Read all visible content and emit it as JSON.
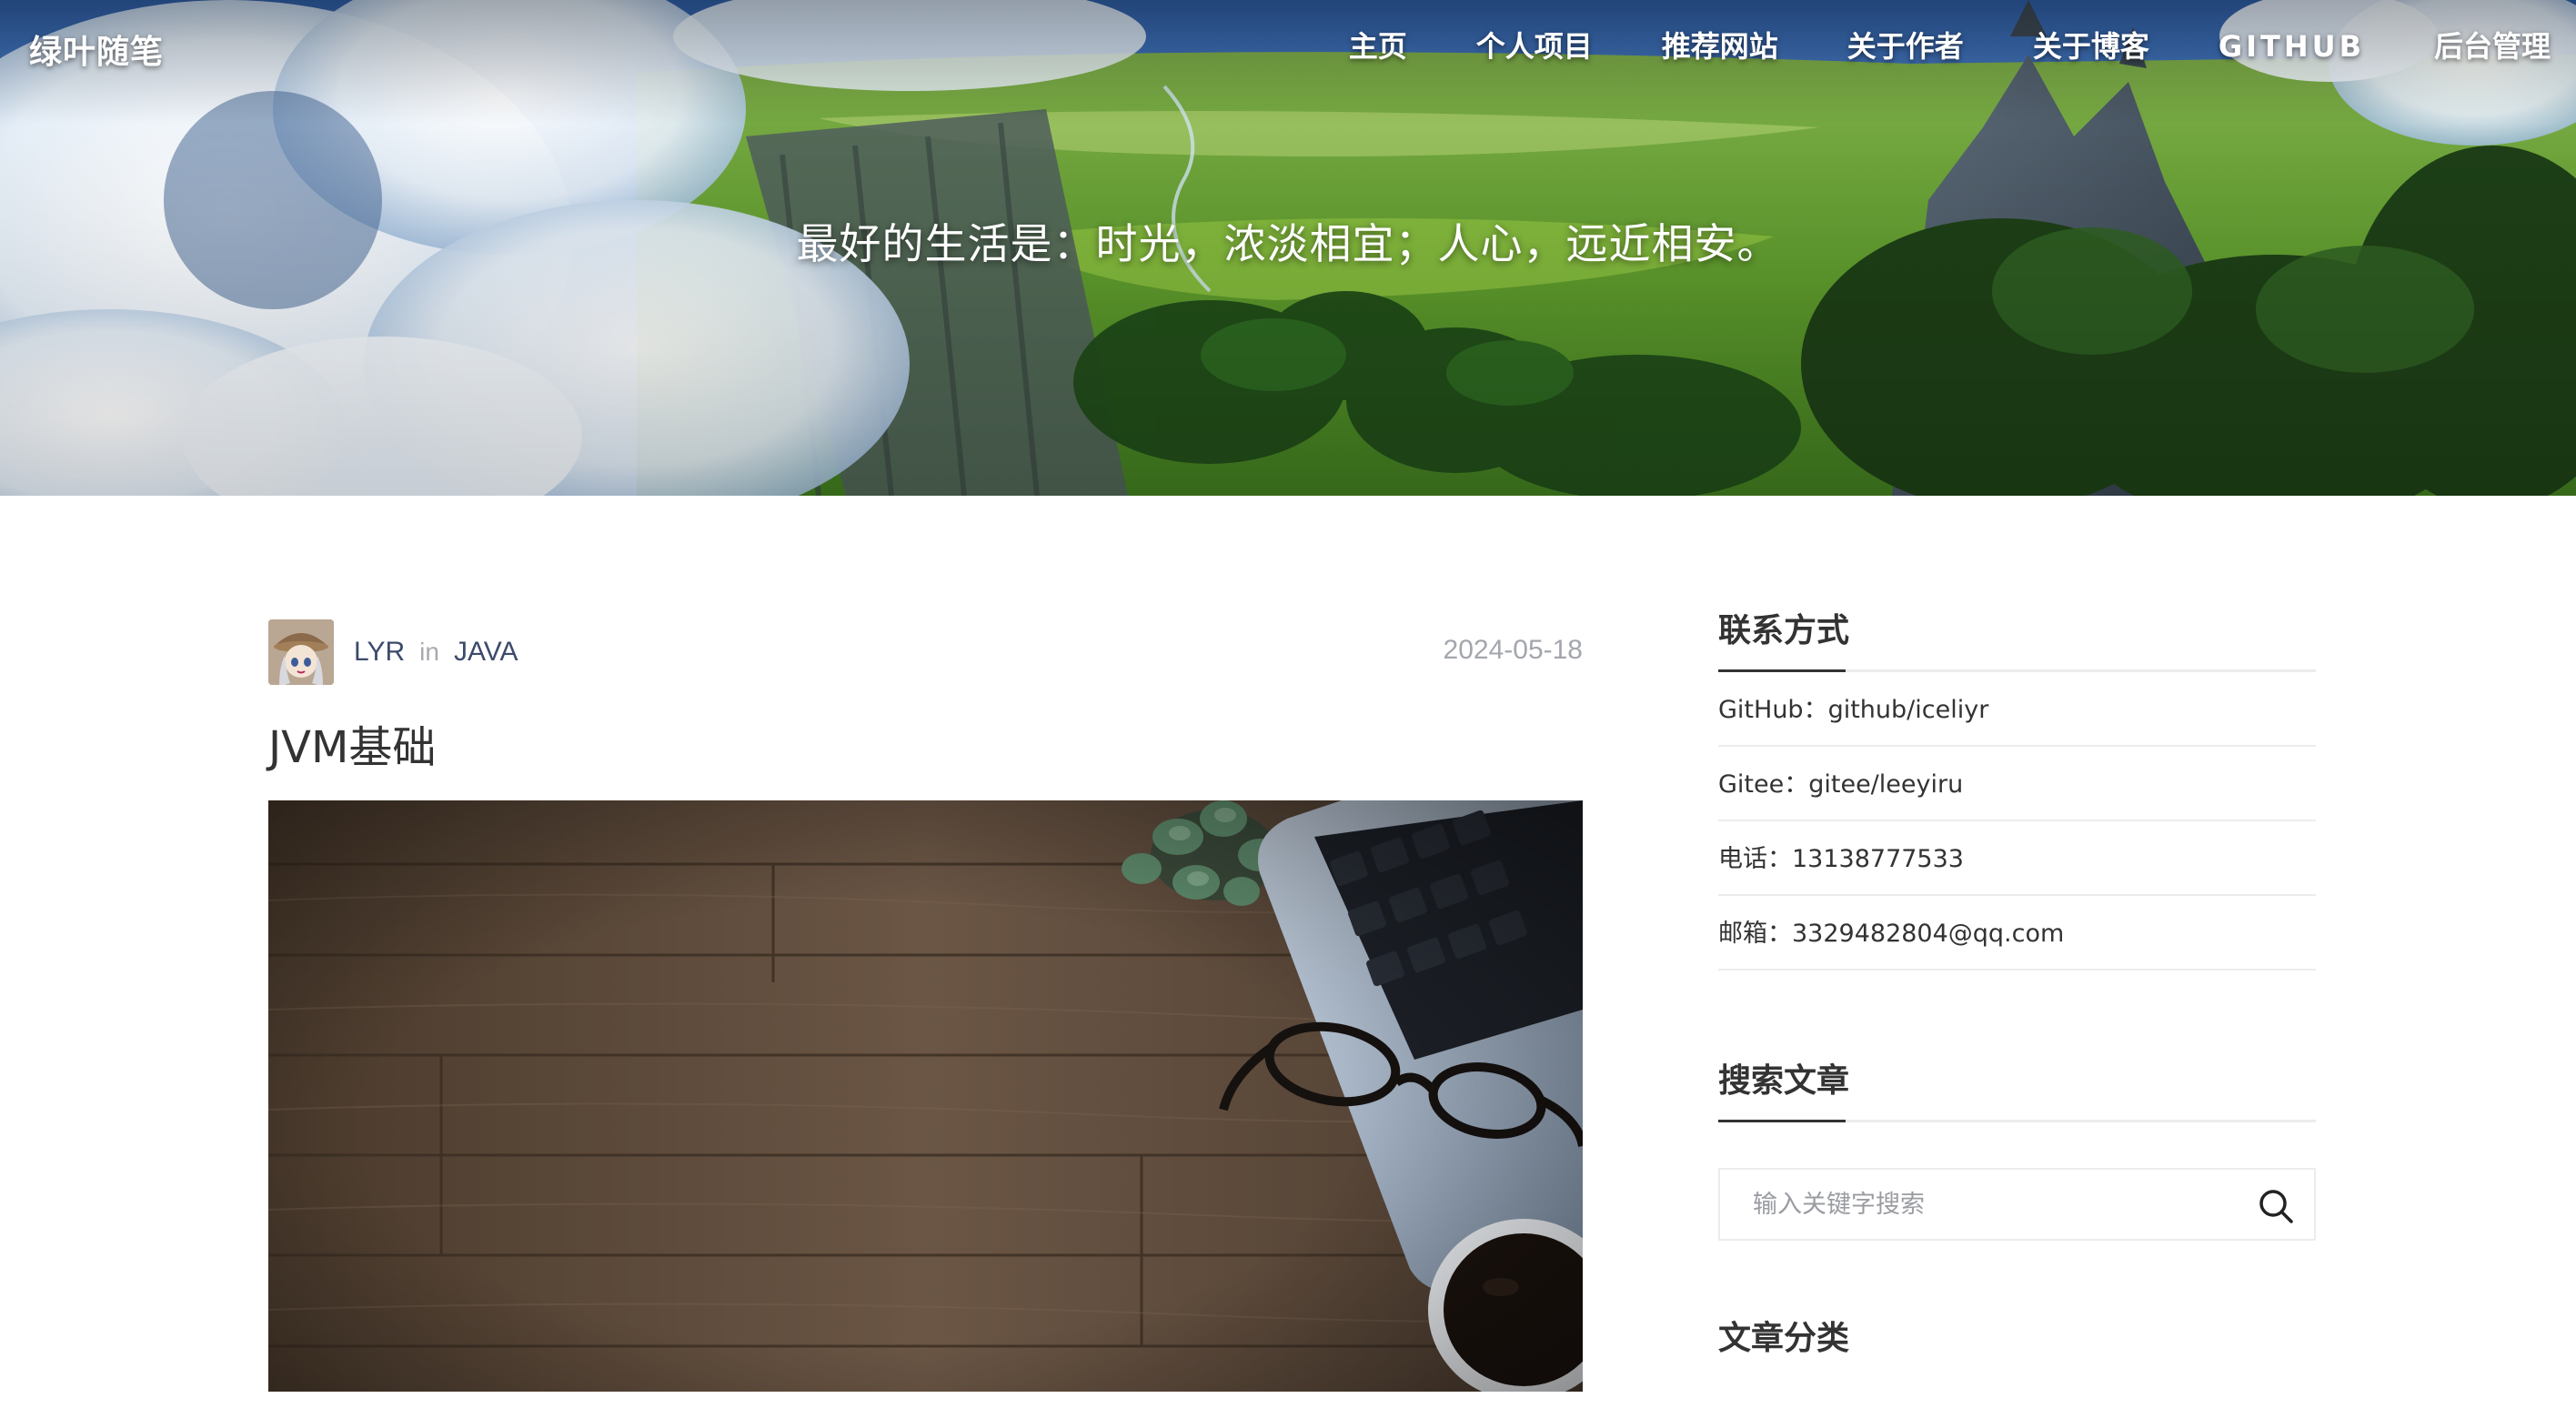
{
  "header": {
    "brand": "绿叶随笔",
    "nav": [
      {
        "label": "主页"
      },
      {
        "label": "个人项目"
      },
      {
        "label": "推荐网站"
      },
      {
        "label": "关于作者"
      },
      {
        "label": "关于博客"
      },
      {
        "label": "GITHUB"
      },
      {
        "label": "后台管理"
      }
    ],
    "motto": "最好的生活是：时光，浓淡相宜；人心，远近相安。"
  },
  "post": {
    "author": "LYR",
    "in_word": "in",
    "category": "JAVA",
    "date": "2024-05-18",
    "title": "JVM基础"
  },
  "sidebar": {
    "contact": {
      "title": "联系方式",
      "items": [
        {
          "key": "GitHub：",
          "value": "github/iceliyr"
        },
        {
          "key": "Gitee：",
          "value": "gitee/leeyiru"
        },
        {
          "key": "电话：",
          "value": "13138777533"
        },
        {
          "key": "邮箱：",
          "value": "3329482804@qq.com"
        }
      ]
    },
    "search": {
      "title": "搜索文章",
      "placeholder": "输入关键字搜索",
      "icon": "search-icon"
    },
    "categories": {
      "title": "文章分类"
    }
  },
  "colors": {
    "accent_text": "#3c4a6b",
    "muted_text": "#a3a6ad",
    "divider": "#ececec",
    "heading": "#333333"
  }
}
